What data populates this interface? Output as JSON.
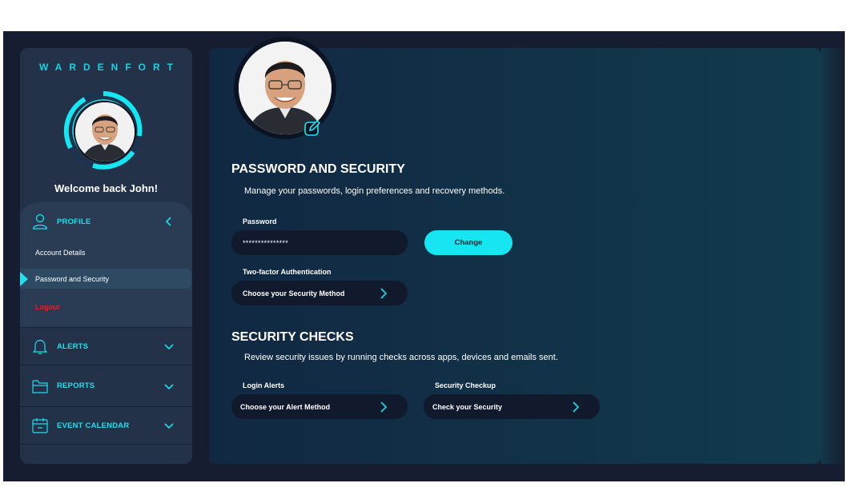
{
  "brand": "WARDENFORT",
  "welcome": "Welcome back John!",
  "colors": {
    "accent": "#18e0ee",
    "danger": "#e51e25",
    "background": "#161d30",
    "panel": "#233248"
  },
  "sidebar": {
    "profile": {
      "label": "PROFILE",
      "icon": "user-icon",
      "items": [
        "Account Details",
        "Password and Security",
        "Logout"
      ],
      "active": "Password and Security"
    },
    "sections": [
      {
        "label": "ALERTS",
        "icon": "bell-icon"
      },
      {
        "label": "REPORTS",
        "icon": "folder-icon"
      },
      {
        "label": "EVENT CALENDAR",
        "icon": "calendar-icon"
      }
    ]
  },
  "main": {
    "password_section": {
      "title": "PASSWORD AND SECURITY",
      "description": "Manage your passwords, login preferences and recovery methods.",
      "password_label": "Password",
      "password_value": "***************",
      "change_button": "Change",
      "twofa_label": "Two-factor Authentication",
      "twofa_value": "Choose your Security Method"
    },
    "checks_section": {
      "title": "SECURITY CHECKS",
      "description": "Review security issues by running checks across apps, devices and emails sent.",
      "login_alerts_label": "Login Alerts",
      "login_alerts_value": "Choose your Alert Method",
      "checkup_label": "Security Checkup",
      "checkup_value": "Check your Security"
    }
  }
}
